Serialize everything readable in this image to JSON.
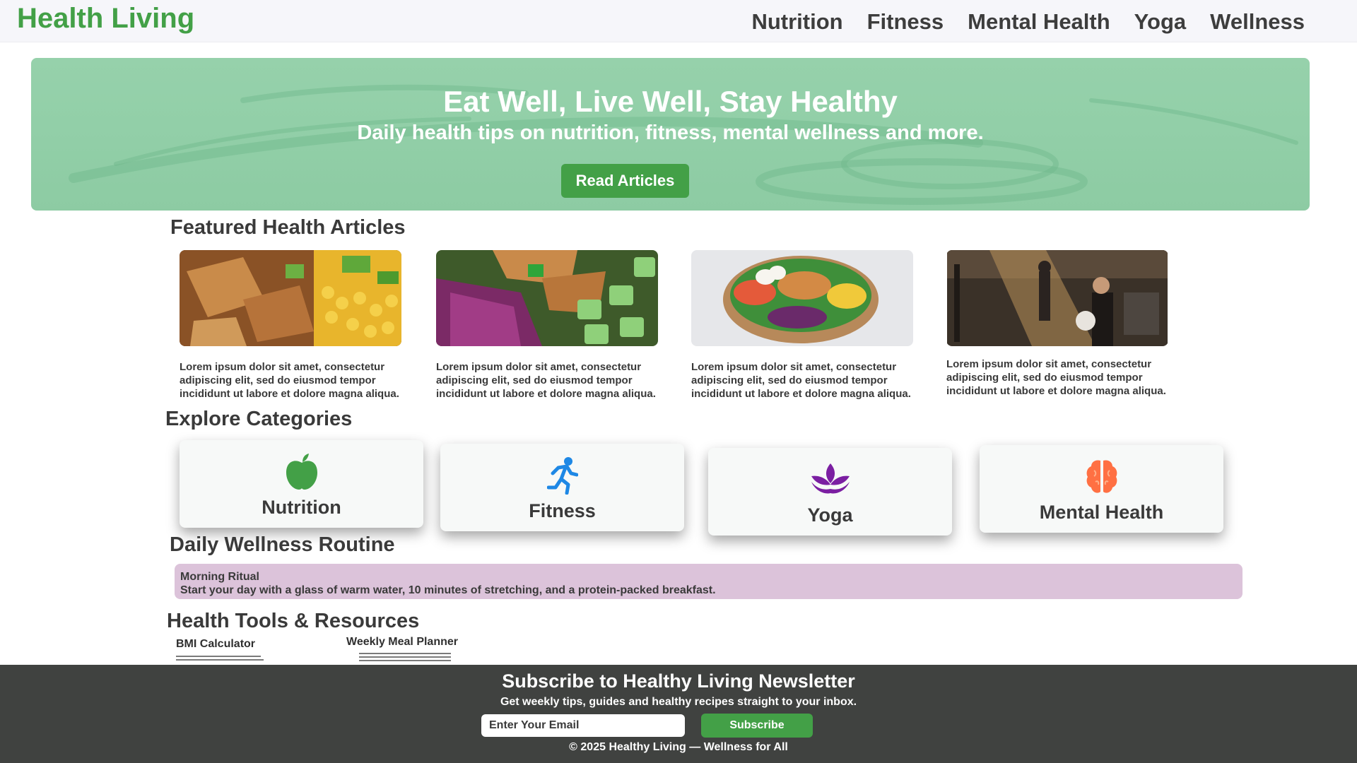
{
  "header": {
    "logo": "Health Living",
    "nav": [
      "Nutrition",
      "Fitness",
      "Mental Health",
      "Yoga",
      "Wellness"
    ]
  },
  "hero": {
    "title": "Eat Well, Live Well, Stay Healthy",
    "subtitle": "Daily health tips on nutrition, fitness, mental wellness and more.",
    "button": "Read Articles"
  },
  "featured": {
    "title": "Featured Health Articles",
    "articles": [
      {
        "image": "tofu-corn-food-photo",
        "text": "Lorem ipsum dolor sit amet, consectetur adipiscing elit, sed do eiusmod tempor incididunt ut labore et dolore magna aliqua."
      },
      {
        "image": "salad-closeup-photo",
        "text": "Lorem ipsum dolor sit amet, consectetur adipiscing elit, sed do eiusmod tempor incididunt ut labore et dolore magna aliqua."
      },
      {
        "image": "salad-bowl-photo",
        "text": "Lorem ipsum dolor sit amet, consectetur adipiscing elit, sed do eiusmod tempor incididunt ut labore et dolore magna aliqua."
      },
      {
        "image": "gym-workout-photo",
        "text": "Lorem ipsum dolor sit amet, consectetur adipiscing elit, sed do eiusmod tempor incididunt ut labore et dolore magna aliqua."
      }
    ]
  },
  "categories": {
    "title": "Explore Categories",
    "items": [
      {
        "label": "Nutrition",
        "icon": "apple-icon",
        "color": "#43a047"
      },
      {
        "label": "Fitness",
        "icon": "running-icon",
        "color": "#1e88e5"
      },
      {
        "label": "Yoga",
        "icon": "lotus-icon",
        "color": "#7b1fa2"
      },
      {
        "label": "Mental Health",
        "icon": "brain-icon",
        "color": "#ff7043"
      }
    ]
  },
  "routine": {
    "title": "Daily Wellness Routine",
    "item_title": "Morning Ritual",
    "item_text": "Start your day with a glass of warm water, 10 minutes of stretching, and a protein-packed breakfast."
  },
  "tools": {
    "title": "Health Tools & Resources",
    "items": [
      {
        "label": "BMI Calculator"
      },
      {
        "label": "Weekly Meal Planner"
      }
    ]
  },
  "footer": {
    "title": "Subscribe to Healthy Living Newsletter",
    "subtitle": "Get weekly tips, guides and healthy recipes straight to your inbox.",
    "email_placeholder": "Enter Your Email",
    "button": "Subscribe",
    "copyright": "© 2025 Healthy Living — Wellness for All"
  },
  "colors": {
    "brand_green": "#43a047",
    "hero_green": "#94d0aa",
    "routine_bg": "#dcc3da",
    "footer_bg": "#404240"
  }
}
